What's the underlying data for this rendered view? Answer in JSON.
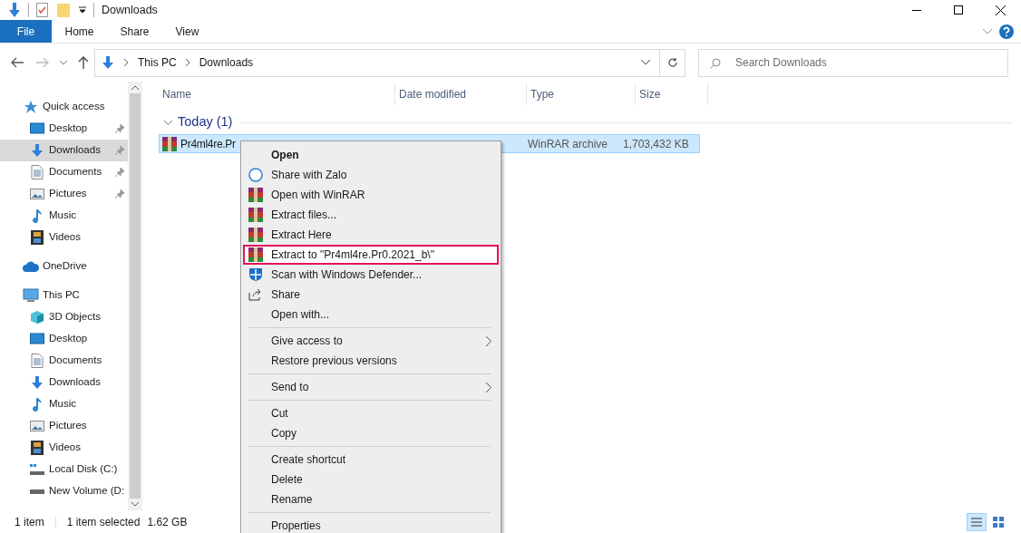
{
  "window": {
    "title": "Downloads"
  },
  "ribbon_tabs": [
    {
      "label": "File",
      "kind": "file",
      "selected": false
    },
    {
      "label": "Home",
      "kind": "tab",
      "selected": false
    },
    {
      "label": "Share",
      "kind": "tab",
      "selected": false
    },
    {
      "label": "View",
      "kind": "tab",
      "selected": false
    }
  ],
  "address_bar": {
    "crumbs": [
      "This PC",
      "Downloads"
    ]
  },
  "search": {
    "placeholder": "Search Downloads"
  },
  "sidebar": {
    "items": [
      {
        "label": "Quick access",
        "kind": "star",
        "selected": false,
        "children": [
          {
            "label": "Desktop",
            "kind": "desktop",
            "pinned": true,
            "selected": false
          },
          {
            "label": "Downloads",
            "kind": "download",
            "pinned": true,
            "selected": true
          },
          {
            "label": "Documents",
            "kind": "document",
            "pinned": true,
            "selected": false
          },
          {
            "label": "Pictures",
            "kind": "pictures",
            "pinned": true,
            "selected": false
          },
          {
            "label": "Music",
            "kind": "music",
            "pinned": false,
            "selected": false
          },
          {
            "label": "Videos",
            "kind": "videos",
            "pinned": false,
            "selected": false
          }
        ]
      },
      {
        "label": "OneDrive",
        "kind": "cloud",
        "selected": false
      },
      {
        "label": "This PC",
        "kind": "pc",
        "selected": false,
        "children": [
          {
            "label": "3D Objects",
            "kind": "cube",
            "selected": false
          },
          {
            "label": "Desktop",
            "kind": "desktop",
            "selected": false
          },
          {
            "label": "Documents",
            "kind": "document",
            "selected": false
          },
          {
            "label": "Downloads",
            "kind": "download",
            "selected": false
          },
          {
            "label": "Music",
            "kind": "music",
            "selected": false
          },
          {
            "label": "Pictures",
            "kind": "pictures",
            "selected": false
          },
          {
            "label": "Videos",
            "kind": "videos",
            "selected": false
          },
          {
            "label": "Local Disk (C:)",
            "kind": "disk",
            "selected": false
          },
          {
            "label": "New Volume (D:",
            "kind": "drive",
            "selected": false
          }
        ]
      }
    ]
  },
  "table": {
    "columns": [
      "Name",
      "Date modified",
      "Type",
      "Size"
    ],
    "groups": [
      {
        "label": "Today (1)",
        "expanded": true,
        "rows": [
          {
            "name": "Pr4ml4re.Pr",
            "type": "WinRAR archive",
            "size": "1,703,432 KB",
            "selected": true
          }
        ]
      }
    ]
  },
  "context_menu": {
    "items": [
      {
        "kind": "plain",
        "label": "Open",
        "default": true,
        "submenu": false,
        "highlighted": false
      },
      {
        "kind": "zalo",
        "label": "Share with Zalo",
        "default": false,
        "submenu": false,
        "highlighted": false
      },
      {
        "kind": "winrar",
        "label": "Open with WinRAR",
        "default": false,
        "submenu": false,
        "highlighted": false
      },
      {
        "kind": "winrar",
        "label": "Extract files...",
        "default": false,
        "submenu": false,
        "highlighted": false
      },
      {
        "kind": "winrar",
        "label": "Extract Here",
        "default": false,
        "submenu": false,
        "highlighted": false
      },
      {
        "kind": "winrar",
        "label": "Extract to \"Pr4ml4re.Pr0.2021_b\\\"",
        "default": false,
        "submenu": false,
        "highlighted": true
      },
      {
        "kind": "defender",
        "label": "Scan with Windows Defender...",
        "default": false,
        "submenu": false,
        "highlighted": false
      },
      {
        "kind": "share",
        "label": "Share",
        "default": false,
        "submenu": false,
        "highlighted": false
      },
      {
        "kind": "plain",
        "label": "Open with...",
        "default": false,
        "submenu": false,
        "highlighted": false
      },
      {
        "kind": "separator"
      },
      {
        "kind": "plain",
        "label": "Give access to",
        "default": false,
        "submenu": true,
        "highlighted": false
      },
      {
        "kind": "plain",
        "label": "Restore previous versions",
        "default": false,
        "submenu": false,
        "highlighted": false
      },
      {
        "kind": "separator"
      },
      {
        "kind": "plain",
        "label": "Send to",
        "default": false,
        "submenu": true,
        "highlighted": false
      },
      {
        "kind": "separator"
      },
      {
        "kind": "plain",
        "label": "Cut",
        "default": false,
        "submenu": false,
        "highlighted": false
      },
      {
        "kind": "plain",
        "label": "Copy",
        "default": false,
        "submenu": false,
        "highlighted": false
      },
      {
        "kind": "separator"
      },
      {
        "kind": "plain",
        "label": "Create shortcut",
        "default": false,
        "submenu": false,
        "highlighted": false
      },
      {
        "kind": "plain",
        "label": "Delete",
        "default": false,
        "submenu": false,
        "highlighted": false
      },
      {
        "kind": "plain",
        "label": "Rename",
        "default": false,
        "submenu": false,
        "highlighted": false
      },
      {
        "kind": "separator"
      },
      {
        "kind": "plain",
        "label": "Properties",
        "default": false,
        "submenu": false,
        "highlighted": false
      }
    ]
  },
  "status_bar": {
    "items": [
      "1 item",
      "1 item selected",
      "1.62 GB"
    ]
  }
}
